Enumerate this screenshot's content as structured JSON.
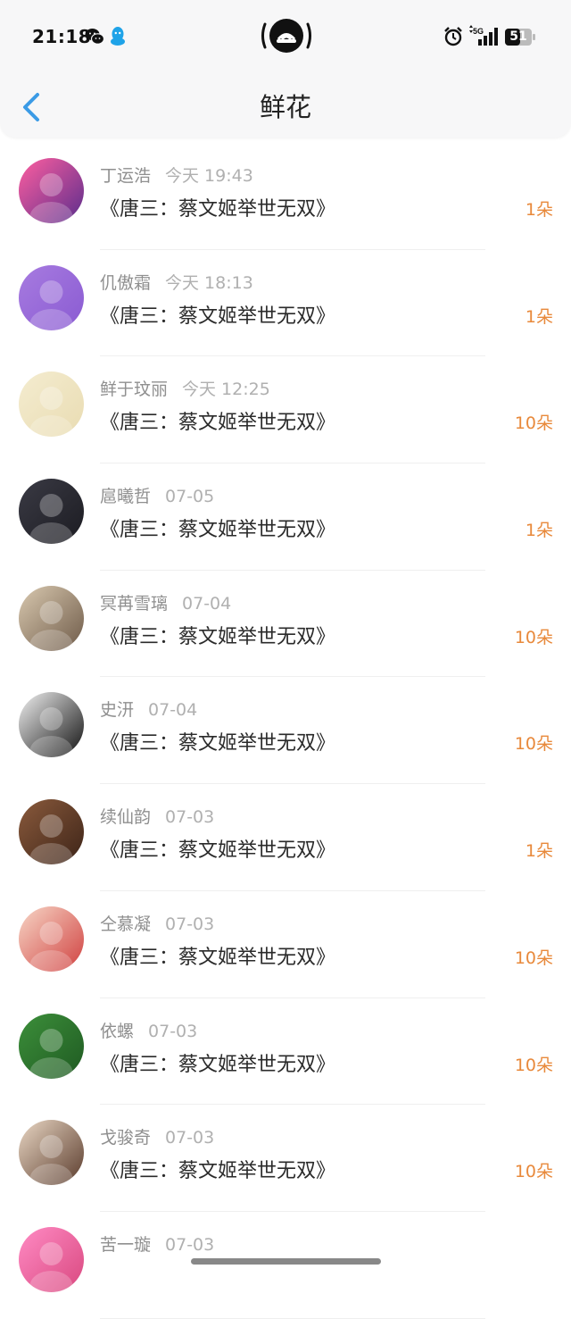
{
  "status_bar": {
    "time": "21:18",
    "network": "5G",
    "battery": "51"
  },
  "header": {
    "title": "鲜花",
    "back_icon": "chevron-left-icon"
  },
  "colors": {
    "accent": "#3b9be6",
    "count": "#e8893b"
  },
  "items": [
    {
      "name": "丁运浩",
      "date": "今天 19:43",
      "book": "《唐三：蔡文姬举世无双》",
      "count": "1朵",
      "avatar": [
        "#ff5fa0",
        "#5a2d8c"
      ]
    },
    {
      "name": "仉傲霜",
      "date": "今天 18:13",
      "book": "《唐三：蔡文姬举世无双》",
      "count": "1朵",
      "avatar": [
        "#a77be0",
        "#8a5bd2"
      ]
    },
    {
      "name": "鲜于玟丽",
      "date": "今天 12:25",
      "book": "《唐三：蔡文姬举世无双》",
      "count": "10朵",
      "avatar": [
        "#f4ecd0",
        "#e9dcb2"
      ]
    },
    {
      "name": "扈曦哲",
      "date": "07-05",
      "book": "《唐三：蔡文姬举世无双》",
      "count": "1朵",
      "avatar": [
        "#3a3a44",
        "#1c1c22"
      ]
    },
    {
      "name": "冥苒雪璃",
      "date": "07-04",
      "book": "《唐三：蔡文姬举世无双》",
      "count": "10朵",
      "avatar": [
        "#d9c9b0",
        "#6e5a48"
      ]
    },
    {
      "name": "史汧",
      "date": "07-04",
      "book": "《唐三：蔡文姬举世无双》",
      "count": "10朵",
      "avatar": [
        "#f2f2f2",
        "#111111"
      ]
    },
    {
      "name": "续仙韵",
      "date": "07-03",
      "book": "《唐三：蔡文姬举世无双》",
      "count": "1朵",
      "avatar": [
        "#8a5a3c",
        "#3d2418"
      ]
    },
    {
      "name": "仝慕凝",
      "date": "07-03",
      "book": "《唐三：蔡文姬举世无双》",
      "count": "10朵",
      "avatar": [
        "#f7d7c7",
        "#d0403f"
      ]
    },
    {
      "name": "依螺",
      "date": "07-03",
      "book": "《唐三：蔡文姬举世无双》",
      "count": "10朵",
      "avatar": [
        "#3c8f3a",
        "#1f5a22"
      ]
    },
    {
      "name": "戈骏奇",
      "date": "07-03",
      "book": "《唐三：蔡文姬举世无双》",
      "count": "10朵",
      "avatar": [
        "#e9d7c4",
        "#5a3b2c"
      ]
    },
    {
      "name": "苦一璇",
      "date": "07-03",
      "book": "",
      "count": "",
      "avatar": [
        "#ff8bc4",
        "#d9487f"
      ]
    }
  ]
}
